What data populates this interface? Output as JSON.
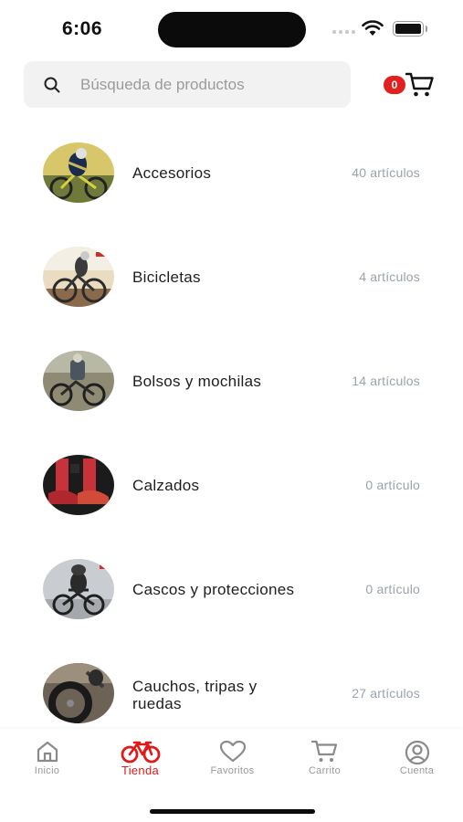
{
  "status_bar": {
    "time": "6:06"
  },
  "search": {
    "placeholder": "Búsqueda de productos"
  },
  "cart": {
    "count": "0"
  },
  "categories": [
    {
      "name": "Accesorios",
      "count": "40 artículos",
      "image": "cyclist-accessories-photo"
    },
    {
      "name": "Bicicletas",
      "count": "4 artículos",
      "image": "road-bike-photo"
    },
    {
      "name": "Bolsos y mochilas",
      "count": "14 artículos",
      "image": "backpack-cyclist-photo"
    },
    {
      "name": "Calzados",
      "count": "0 artículo",
      "image": "cycling-shoes-photo"
    },
    {
      "name": "Cascos y protecciones",
      "count": "0 artículo",
      "image": "helmet-rider-photo"
    },
    {
      "name": "Cauchos, tripas y ruedas",
      "count": "27 artículos",
      "image": "tire-wheel-photo"
    }
  ],
  "tabs": [
    {
      "label": "Inicio",
      "icon": "home-icon",
      "active": false
    },
    {
      "label": "Tienda",
      "icon": "bicycle-icon",
      "active": true
    },
    {
      "label": "Favoritos",
      "icon": "heart-icon",
      "active": false
    },
    {
      "label": "Carrito",
      "icon": "cart-icon",
      "active": false
    },
    {
      "label": "Cuenta",
      "icon": "account-icon",
      "active": false
    }
  ],
  "colors": {
    "accent": "#e01a1a",
    "badge": "#e32020",
    "muted_text": "#9aa3ad",
    "search_bg": "#f2f2f2"
  }
}
